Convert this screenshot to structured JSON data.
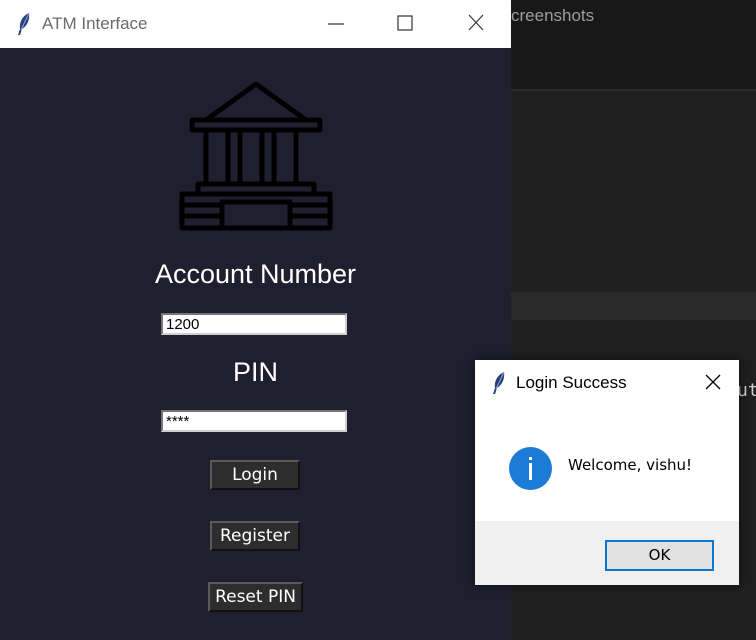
{
  "background": {
    "tab_text": "creenshots",
    "code_fragment": "ut"
  },
  "atm_window": {
    "title": "ATM Interface",
    "icons": [
      "feather-icon",
      "minimize-icon",
      "maximize-icon",
      "close-icon",
      "bank-icon"
    ],
    "account_label": "Account Number",
    "account_value": "1200",
    "pin_label": "PIN",
    "pin_value": "****",
    "login_label": "Login",
    "register_label": "Register",
    "reset_label": "Reset PIN",
    "background_color": "#1f1f30"
  },
  "dialog": {
    "title": "Login Success",
    "message": "Welcome, vishu!",
    "ok_label": "OK",
    "icons": [
      "feather-icon",
      "close-icon",
      "info-icon"
    ],
    "accent_color": "#0078d7"
  }
}
